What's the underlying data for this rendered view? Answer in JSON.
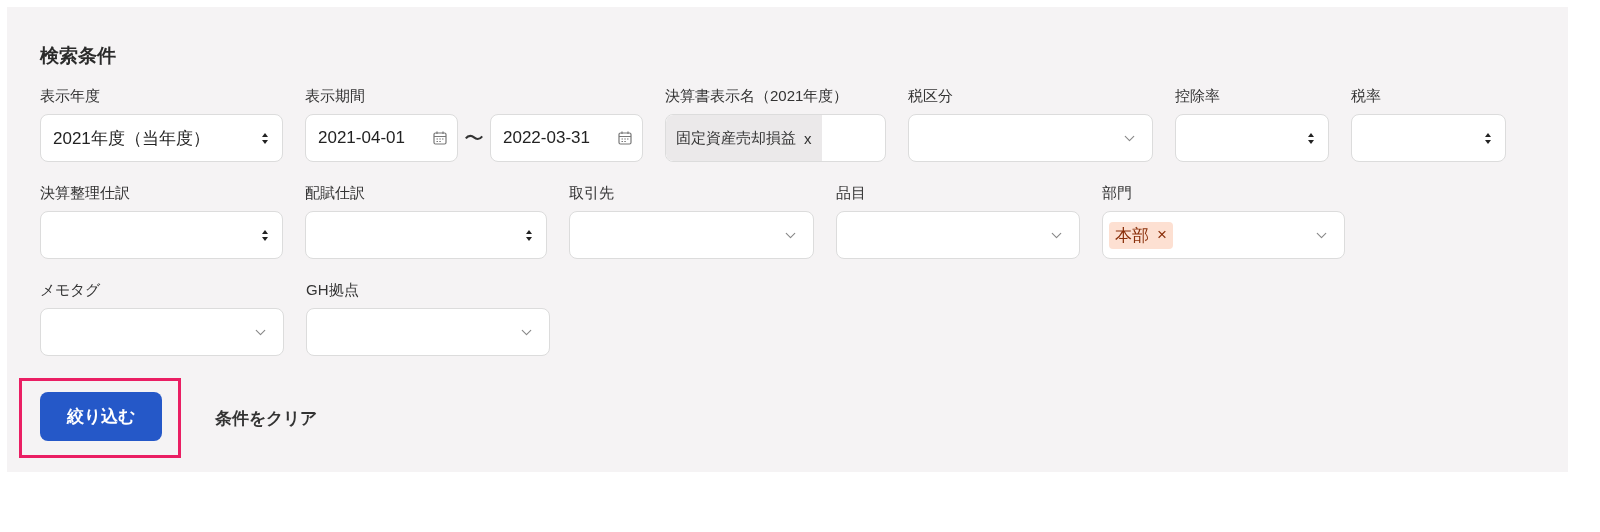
{
  "panel": {
    "title": "検索条件",
    "rows": [
      [
        {
          "label": "表示年度",
          "kind": "select",
          "value": "2021年度（当年度）"
        },
        {
          "label": "表示期間",
          "kind": "date-range",
          "from": "2021-04-01",
          "separator": "〜",
          "to": "2022-03-31"
        },
        {
          "label": "決算書表示名（2021年度）",
          "kind": "chip-input",
          "chips": [
            {
              "text": "固定資産売却損益",
              "remove": "x"
            }
          ]
        },
        {
          "label": "税区分",
          "kind": "combo"
        },
        {
          "label": "控除率",
          "kind": "select"
        },
        {
          "label": "税率",
          "kind": "select"
        }
      ],
      [
        {
          "label": "決算整理仕訳",
          "kind": "select"
        },
        {
          "label": "配賦仕訳",
          "kind": "select"
        },
        {
          "label": "取引先",
          "kind": "combo"
        },
        {
          "label": "品目",
          "kind": "combo"
        },
        {
          "label": "部門",
          "kind": "tag-combo",
          "chips": [
            {
              "text": "本部",
              "remove": "×"
            }
          ]
        }
      ],
      [
        {
          "label": "メモタグ",
          "kind": "combo"
        },
        {
          "label": "GH拠点",
          "kind": "combo"
        }
      ]
    ],
    "submit": {
      "label": "絞り込む",
      "highlighted": true
    },
    "clear": {
      "label": "条件をクリア"
    }
  }
}
